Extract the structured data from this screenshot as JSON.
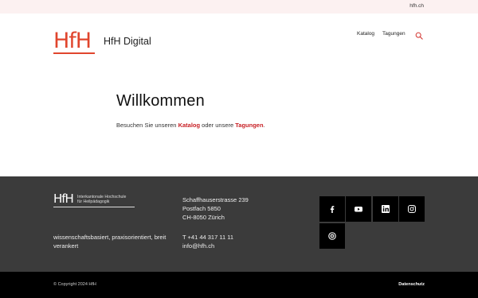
{
  "topbar": {
    "link": "hfh.ch"
  },
  "header": {
    "logo_text": "HfH",
    "site_name": "HfH Digital",
    "nav": [
      {
        "label": "Katalog"
      },
      {
        "label": "Tagungen"
      }
    ],
    "search_icon": "search-icon",
    "brand_color": "#e0452d"
  },
  "main": {
    "title": "Willkommen",
    "intro_before": "Besuchen Sie unseren ",
    "link_katalog": "Katalog",
    "intro_middle": " oder unsere ",
    "link_tagungen": "Tagungen",
    "intro_after": ".",
    "link_color": "#c81f24"
  },
  "footer": {
    "logo_mark": "HfH",
    "institution_line1": "Interkantonale Hochschule",
    "institution_line2": "für Heilpädagogik",
    "tagline": "wissenschaftsbasiert, praxisorientiert, breit verankert",
    "address": [
      "Schaffhauserstrasse 239",
      "Postfach 5850",
      "CH-8050 Zürich"
    ],
    "phone": "T +41 44 317 11 11",
    "email": "info@hfh.ch",
    "social": [
      {
        "icon": "facebook-icon"
      },
      {
        "icon": "youtube-icon"
      },
      {
        "icon": "linkedin-icon"
      },
      {
        "icon": "instagram-icon"
      },
      {
        "icon": "podcast-icon"
      }
    ],
    "background": "#3b3b3b"
  },
  "bottom": {
    "copyright": "© Copyright 2024 HfH",
    "privacy": "Datenschutz"
  }
}
